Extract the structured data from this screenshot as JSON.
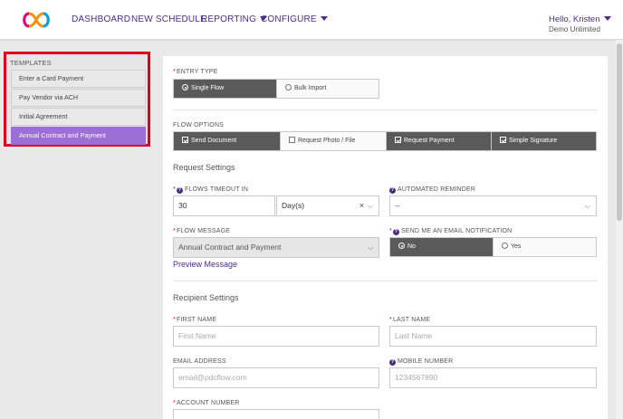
{
  "header": {
    "nav": [
      {
        "label": "DASHBOARD"
      },
      {
        "label": "NEW SCHEDULE"
      },
      {
        "label": "REPORTING"
      },
      {
        "label": "CONFIGURE"
      }
    ],
    "user_greeting": "Hello, Kristen",
    "user_org": "Demo Unlimited"
  },
  "templates": {
    "heading": "TEMPLATES",
    "items": [
      {
        "label": "Enter a Card Payment"
      },
      {
        "label": "Pay Vendor via ACH"
      },
      {
        "label": "Initial Agreement"
      },
      {
        "label": "Annual Contract and Payment",
        "active": true
      }
    ]
  },
  "form": {
    "entry_type": {
      "label": "ENTRY TYPE",
      "options": [
        "Single Flow",
        "Bulk Import"
      ],
      "selected": "Single Flow"
    },
    "flow_options": {
      "label": "FLOW OPTIONS",
      "options": [
        {
          "label": "Send Document",
          "checked": true
        },
        {
          "label": "Request Photo / File",
          "checked": false
        },
        {
          "label": "Request Payment",
          "checked": true
        },
        {
          "label": "Simple Signature",
          "checked": true
        }
      ]
    },
    "request_settings": {
      "title": "Request Settings",
      "timeout_label": "FLOWS TIMEOUT IN",
      "timeout_value": "30",
      "timeout_unit": "Day(s)",
      "reminder_label": "AUTOMATED REMINDER",
      "reminder_value": "--",
      "message_label": "FLOW MESSAGE",
      "message_value": "Annual Contract and Payment",
      "preview_link": "Preview Message",
      "email_notify_label": "SEND ME AN EMAIL NOTIFICATION",
      "email_notify_options": [
        "No",
        "Yes"
      ],
      "email_notify_selected": "No"
    },
    "recipient_settings": {
      "title": "Recipient Settings",
      "first_name_label": "FIRST NAME",
      "first_name_placeholder": "First Name",
      "last_name_label": "LAST NAME",
      "last_name_placeholder": "Last Name",
      "email_label": "EMAIL ADDRESS",
      "email_placeholder": "email@pdcflow.com",
      "mobile_label": "MOBILE NUMBER",
      "mobile_placeholder": "1234567890",
      "account_label": "ACCOUNT NUMBER"
    }
  },
  "colors": {
    "brand": "#4b2d83",
    "active_template": "#9b6fd6",
    "selected_segment": "#5a5a5a",
    "highlight_border": "#e0001b"
  }
}
